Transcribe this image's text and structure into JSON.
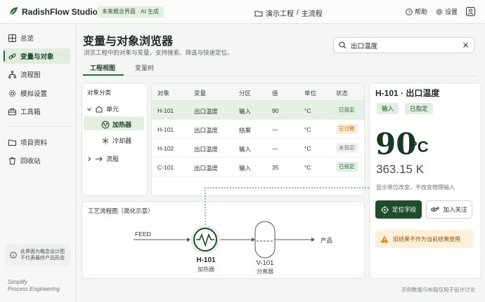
{
  "app": {
    "title": "RadishFlow Studio",
    "badge": "未来概念界面 · AI 生成"
  },
  "breadcrumb": {
    "project": "演示工程",
    "separator": "/",
    "flow": "主流程"
  },
  "top_actions": {
    "help": "帮助",
    "settings": "设置"
  },
  "sidebar": {
    "items": [
      {
        "label": "总览",
        "icon": "grid-icon"
      },
      {
        "label": "变量与对象",
        "icon": "link-icon",
        "active": true
      },
      {
        "label": "流程图",
        "icon": "flow-icon"
      },
      {
        "label": "模拟设置",
        "icon": "gear-icon"
      },
      {
        "label": "工具箱",
        "icon": "toolbox-icon"
      },
      {
        "label": "项目资料",
        "icon": "folder-icon"
      },
      {
        "label": "回收站",
        "icon": "trash-icon"
      }
    ],
    "note": [
      "此界面为概念设计图",
      "不代表最终产品形态"
    ],
    "slogan": [
      "Simplify",
      "Process Engineering"
    ]
  },
  "page": {
    "title": "变量与对象浏览器",
    "subtitle": "浏览工程中的对象与变量，支持搜索、筛选与快速定位。",
    "search_value": "出口温度"
  },
  "tabs": [
    {
      "label": "工程视图",
      "active": true
    },
    {
      "label": "变量树"
    }
  ],
  "tree": {
    "title": "对象分类",
    "unit": "单元",
    "heater": "加热器",
    "cooler": "冷却器",
    "stream": "流股"
  },
  "table": {
    "headers": [
      "对象",
      "变量",
      "分区",
      "值",
      "单位",
      "状态"
    ],
    "rows": [
      {
        "object": "H-101",
        "variable": "出口温度",
        "zone": "输入",
        "value": "90",
        "unit": "°C",
        "status": "已指定",
        "kind": "ok"
      },
      {
        "object": "H-101",
        "variable": "出口温度",
        "zone": "结果",
        "value": "—",
        "unit": "°C",
        "status": "已过期",
        "kind": "warn"
      },
      {
        "object": "H-102",
        "variable": "出口温度",
        "zone": "输入",
        "value": "—",
        "unit": "°C",
        "status": "未指定",
        "kind": "na"
      },
      {
        "object": "C-101",
        "variable": "出口温度",
        "zone": "输入",
        "value": "35",
        "unit": "°C",
        "status": "已指定",
        "kind": "ok"
      }
    ]
  },
  "detail": {
    "title": "H-101 · 出口温度",
    "tag_zone": "输入",
    "tag_status": "已指定",
    "value": "90",
    "unit": "°C",
    "kelvin": "363.15 K",
    "note": "显示单位改变，不改变物理输入",
    "locate_button": "定位字段",
    "watch_button": "加入关注",
    "warning": "旧结果不作为当前结果使用"
  },
  "flow": {
    "title": "工艺流程图（简化示意）",
    "feed": "FEED",
    "product": "产品",
    "heater_tag": "H-101",
    "heater_name": "加热器",
    "separator_tag": "V-101",
    "separator_name": "分离器"
  },
  "footer_note": "示例数据与布局仅用于设计讨论",
  "colors": {
    "accent": "#1f4d2c",
    "accent_light": "#e2ede1",
    "warn": "#b36b12"
  }
}
